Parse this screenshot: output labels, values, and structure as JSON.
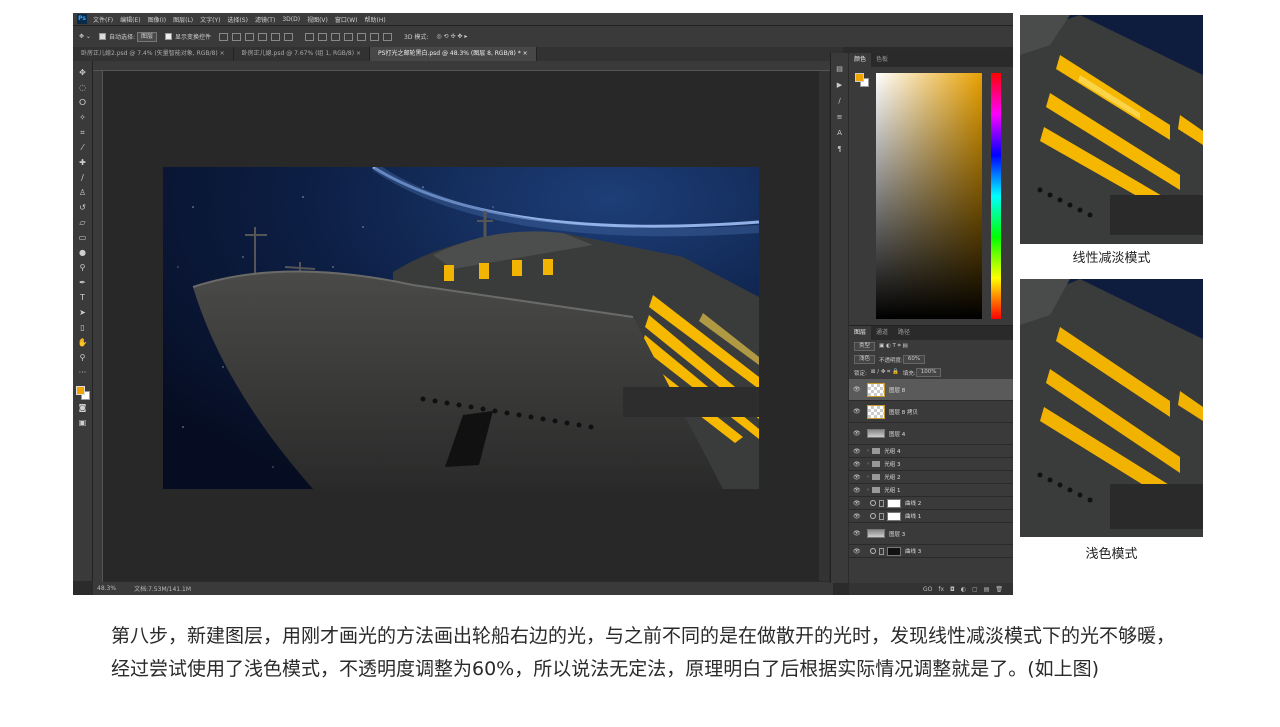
{
  "app": {
    "logo": "Ps",
    "menu": [
      "文件(F)",
      "编辑(E)",
      "图像(I)",
      "图层(L)",
      "文字(Y)",
      "选择(S)",
      "滤镜(T)",
      "3D(D)",
      "视图(V)",
      "窗口(W)",
      "帮助(H)"
    ]
  },
  "options_bar": {
    "auto_select_label": "自动选择:",
    "auto_select_value": "图层",
    "show_transform_label": "显示变换控件",
    "mode_3d_label": "3D 模式:"
  },
  "tabs": [
    {
      "label": "卧房正儿媳2.psd @ 7.4% (矢量智能对象, RGB/8) ×",
      "active": false
    },
    {
      "label": "卧房正儿媳.psd @ 7.67% (组 1, RGB/8) ×",
      "active": false
    },
    {
      "label": "PS打光之邮轮黑白.psd @ 48.3% (图层 8, RGB/8) * ×",
      "active": true
    }
  ],
  "status": {
    "zoom": "48.3%",
    "doc": "文档:7.53M/141.1M"
  },
  "panels": {
    "color_tabs": [
      "颜色",
      "色板"
    ],
    "layer_tabs": [
      "图层",
      "通道",
      "路径"
    ],
    "kind_label": "类型",
    "blend_mode": "浅色",
    "opacity_label": "不透明度:",
    "opacity_value": "60%",
    "lock_label": "锁定:",
    "fill_label": "填充:",
    "fill_value": "100%",
    "footer": [
      "GO",
      "fx",
      "◘",
      "◐",
      "▢",
      "▤",
      "🗑"
    ],
    "layers": [
      {
        "name": "图层 8",
        "type": "checker",
        "selected": true
      },
      {
        "name": "图层 8 拷贝",
        "type": "checker",
        "selected": false
      },
      {
        "name": "图层 4",
        "type": "stripe",
        "selected": false
      },
      {
        "name": "光组 4",
        "type": "folder",
        "selected": false
      },
      {
        "name": "光组 3",
        "type": "folder",
        "selected": false
      },
      {
        "name": "光组 2",
        "type": "folder",
        "selected": false
      },
      {
        "name": "光组 1",
        "type": "folder",
        "selected": false
      },
      {
        "name": "曲线 2",
        "type": "curve-white",
        "selected": false
      },
      {
        "name": "曲线 1",
        "type": "curve-white",
        "selected": false
      },
      {
        "name": "图层 3",
        "type": "stripe",
        "selected": false
      },
      {
        "name": "曲线 3",
        "type": "curve-black",
        "selected": false
      }
    ]
  },
  "captions": {
    "top": "线性减淡模式",
    "bottom": "浅色模式"
  },
  "paragraph": "第八步，新建图层，用刚才画光的方法画出轮船右边的光，与之前不同的是在做散开的光时，发现线性减淡模式下的光不够暖，经过尝试使用了浅色模式，不透明度调整为60%，所以说法无定法，原理明白了后根据实际情况调整就是了。(如上图)"
}
